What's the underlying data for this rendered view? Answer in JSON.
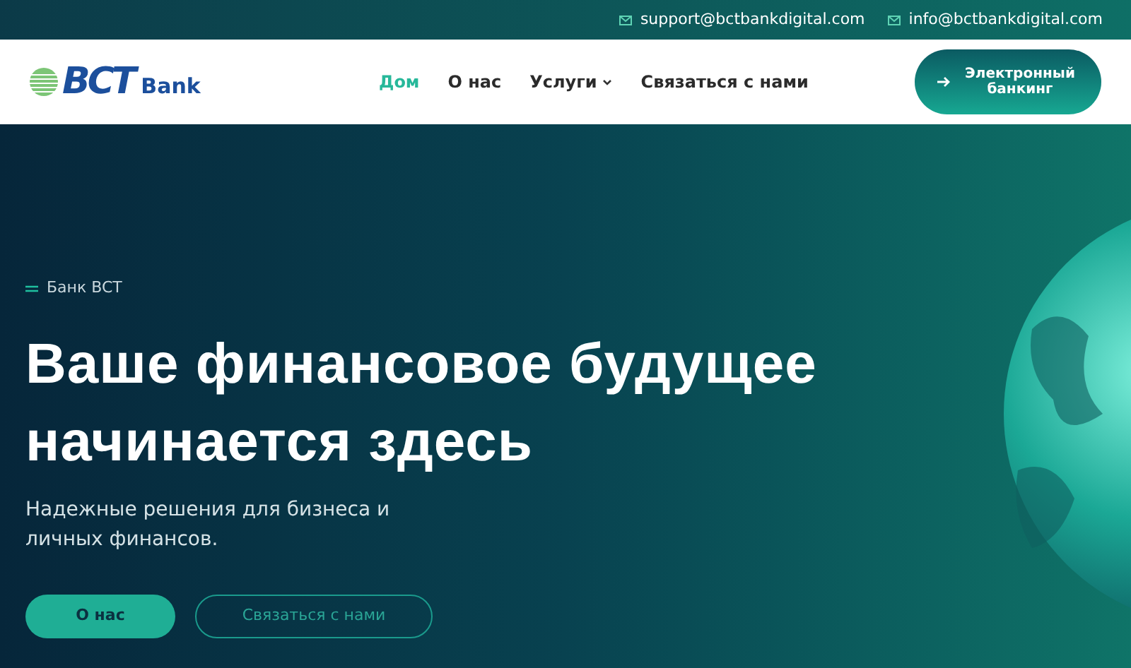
{
  "top_bar": {
    "emails": [
      "support@bctbankdigital.com",
      "info@bctbankdigital.com"
    ]
  },
  "header": {
    "logo": {
      "mark": "BCT",
      "word": "Bank"
    },
    "nav": [
      {
        "label": "Дом",
        "selected": true,
        "dropdown": false
      },
      {
        "label": "О нас",
        "selected": false,
        "dropdown": false
      },
      {
        "label": "Услуги",
        "selected": false,
        "dropdown": true
      },
      {
        "label": "Связаться с нами",
        "selected": false,
        "dropdown": false
      }
    ],
    "cta_button": "Электронный банкинг"
  },
  "hero": {
    "eyebrow": "Банк BCT",
    "headline": "Ваше финансовое будущее начинается здесь",
    "subtitle": "Надежные решения для бизнеса и личных финансов.",
    "buttons": [
      {
        "label": "О нас",
        "kind": "filled"
      },
      {
        "label": "Связаться с нами",
        "kind": "outline"
      }
    ]
  }
}
